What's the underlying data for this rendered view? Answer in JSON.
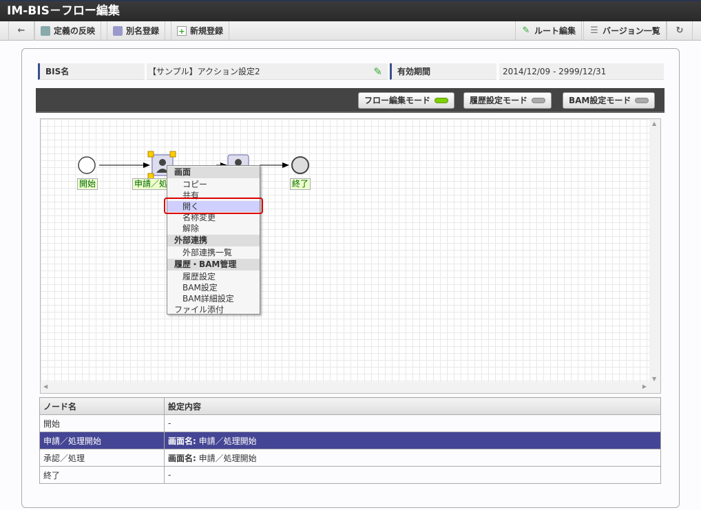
{
  "title": "IM-BIS－フロー編集",
  "toolbar": {
    "back": "←",
    "reflect": "定義の反映",
    "alias": "別名登録",
    "new": "新規登録",
    "route_edit": "ルート編集",
    "versions": "バージョン一覧",
    "refresh": "↻"
  },
  "info": {
    "bis_label": "BIS名",
    "bis_value": "【サンプル】アクション設定2",
    "period_label": "有効期間",
    "period_value": "2014/12/09 - 2999/12/31"
  },
  "modes": [
    {
      "label": "フロー編集モード",
      "active": true
    },
    {
      "label": "履歴設定モード",
      "active": false
    },
    {
      "label": "BAM設定モード",
      "active": false
    }
  ],
  "nodes": {
    "start": "開始",
    "task1": "申請／処理開始",
    "end": "終了"
  },
  "menu": {
    "h1": "画面",
    "copy": "コピー",
    "share": "共有",
    "open": "開く",
    "rename": "名称変更",
    "release": "解除",
    "h2": "外部連携",
    "ext_list": "外部連携一覧",
    "h3": "履歴・BAM管理",
    "hist": "履歴設定",
    "bam": "BAM設定",
    "bam_detail": "BAM詳細設定",
    "attach": "ファイル添付"
  },
  "table": {
    "headers": [
      "ノード名",
      "設定内容"
    ],
    "rows": [
      {
        "name": "開始",
        "key": "",
        "value": "-"
      },
      {
        "name": "申請／処理開始",
        "key": "画面名:",
        "value": " 申請／処理開始"
      },
      {
        "name": "承認／処理",
        "key": "画面名:",
        "value": " 申請／処理開始"
      },
      {
        "name": "終了",
        "key": "",
        "value": "-"
      }
    ]
  }
}
